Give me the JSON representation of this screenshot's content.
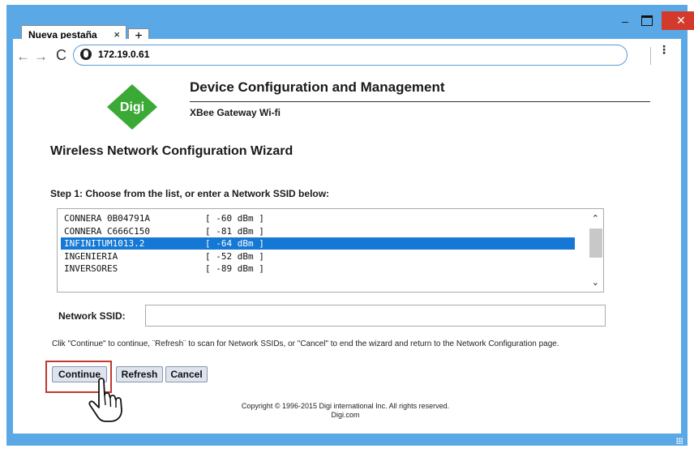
{
  "window": {
    "tab_title": "Nueva pestaña",
    "tab_close": "×",
    "new_tab": "+",
    "minimize": "_",
    "close": "✕"
  },
  "toolbar": {
    "back": "←",
    "forward": "→",
    "reload": "C",
    "url": "172.19.0.61",
    "menu": "⋮"
  },
  "header": {
    "title": "Device Configuration and Management",
    "subtitle": "XBee Gateway Wi-fi",
    "logo_text": "Digi",
    "logo_color": "#3aa935"
  },
  "wizard": {
    "title": "Wireless Network Configuration Wizard",
    "step_label": "Step 1: Choose from the list, or enter a Network SSID below:",
    "networks": [
      {
        "name": "CONNERA 0B04791A",
        "signal": "[ -60 dBm ]"
      },
      {
        "name": "CONNERA C666C150",
        "signal": "[ -81 dBm ]"
      },
      {
        "name": "INFINITUM1013.2",
        "signal": "[ -64 dBm ]"
      },
      {
        "name": "INGENIERIA",
        "signal": "[ -52 dBm ]"
      },
      {
        "name": "INVERSORES",
        "signal": "[ -89 dBm ]"
      }
    ],
    "selected_index": 2,
    "ssid_label": "Network SSID:",
    "ssid_value": "",
    "help_text": "Clik \"Continue\" to continue, ¨Refresh¨ to scan for Network SSIDs, or \"Cancel\" to end the wizard and return to the Network Configuration page.",
    "buttons": {
      "continue": "Continue",
      "refresh": "Refresh",
      "cancel": "Cancel"
    }
  },
  "footer": {
    "copyright": "Copyright © 1996-2015 Digi international Inc. All rights reserved.",
    "site": "Digi.com"
  },
  "colors": {
    "window_frame": "#5aa9e6",
    "selection": "#1478d4",
    "highlight": "#c0392b",
    "close_button": "#d33a2c"
  }
}
